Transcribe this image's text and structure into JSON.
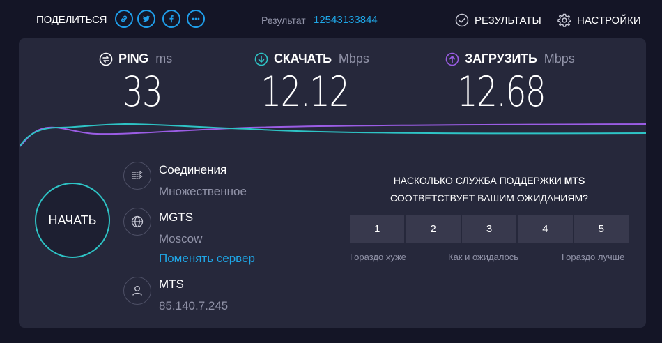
{
  "header": {
    "share_label": "ПОДЕЛИТЬСЯ",
    "share_icons": [
      "link-icon",
      "twitter-icon",
      "facebook-icon",
      "more-icon"
    ],
    "result_label": "Результат",
    "result_id": "12543133844",
    "results_label": "РЕЗУЛЬТАТЫ",
    "settings_label": "НАСТРОЙКИ"
  },
  "metrics": {
    "ping": {
      "name": "PING",
      "unit": "ms",
      "value": "33"
    },
    "download": {
      "name": "СКАЧАТЬ",
      "unit": "Mbps",
      "value": "12.12"
    },
    "upload": {
      "name": "ЗАГРУЗИТЬ",
      "unit": "Mbps",
      "value": "12.68"
    }
  },
  "start_button": "НАЧАТЬ",
  "connections": {
    "title": "Соединения",
    "value": "Множественное"
  },
  "server": {
    "name": "MGTS",
    "location": "Moscow",
    "change_link": "Поменять сервер"
  },
  "provider": {
    "name": "MTS",
    "ip": "85.140.7.245"
  },
  "survey": {
    "question_prefix": "НАСКОЛЬКО СЛУЖБА ПОДДЕРЖКИ",
    "provider": "MTS",
    "question_suffix": "СООТВЕТСТВУЕТ ВАШИМ ОЖИДАНИЯМ?",
    "options": [
      "1",
      "2",
      "3",
      "4",
      "5"
    ],
    "label_low": "Гораздо хуже",
    "label_mid": "Как и ожидалось",
    "label_high": "Гораздо лучше"
  },
  "colors": {
    "accent": "#1fa6e6",
    "download": "#2ec4c6",
    "upload": "#9b5de5",
    "panel": "#26283b",
    "background": "#141526"
  }
}
